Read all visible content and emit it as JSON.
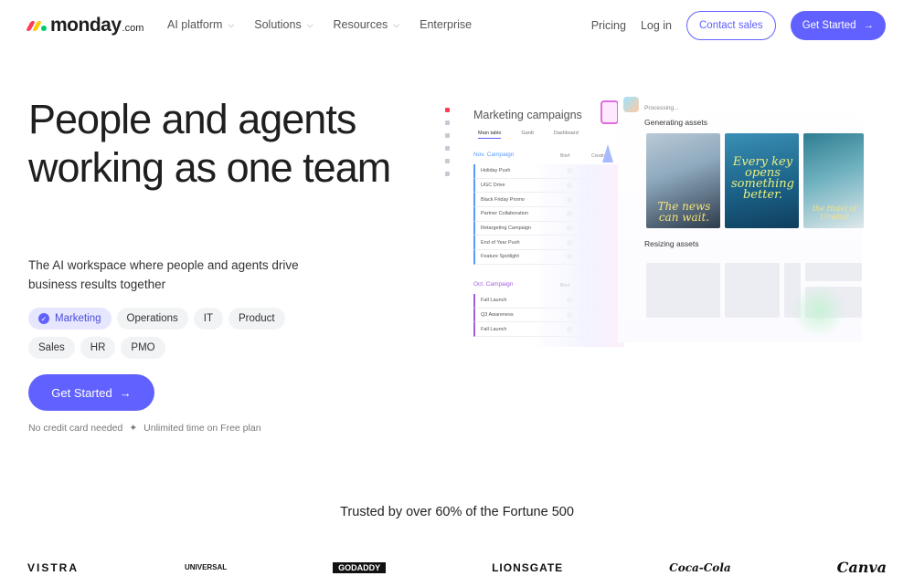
{
  "brand": {
    "name": "monday",
    "suffix": ".com",
    "colors": [
      "#ff3d57",
      "#ffcb00",
      "#00ca72"
    ]
  },
  "nav": {
    "items": [
      {
        "label": "AI platform",
        "dropdown": true
      },
      {
        "label": "Solutions",
        "dropdown": true
      },
      {
        "label": "Resources",
        "dropdown": true
      },
      {
        "label": "Enterprise",
        "dropdown": false
      }
    ],
    "pricing": "Pricing",
    "login": "Log in",
    "contact": "Contact sales",
    "get_started": "Get Started"
  },
  "hero": {
    "title": "People and agents working as one team",
    "subtitle": "The AI workspace where people and agents drive business results together",
    "chips": [
      {
        "label": "Marketing",
        "selected": true
      },
      {
        "label": "Operations",
        "selected": false
      },
      {
        "label": "IT",
        "selected": false
      },
      {
        "label": "Product",
        "selected": false
      },
      {
        "label": "Sales",
        "selected": false
      },
      {
        "label": "HR",
        "selected": false
      },
      {
        "label": "PMO",
        "selected": false
      }
    ],
    "cta": "Get Started",
    "note_1": "No credit card needed",
    "note_sep": "✦",
    "note_2": "Unlimited time on Free plan"
  },
  "mockup": {
    "board_title": "Marketing campaigns",
    "tabs": [
      "Main table",
      "Gantt",
      "Dashboard"
    ],
    "group_nov": "Nov. Campaign",
    "group_oct": "Oct. Campaign",
    "col_brief": "Brief",
    "col_creatives": "Creatives",
    "nov_rows": [
      "Holiday Push",
      "UGC Drive",
      "Black Friday Promo",
      "Partner Collaboration",
      "Retargeting Campaign",
      "End of Year Push",
      "Feature Spotlight"
    ],
    "oct_rows": [
      "Fall Launch",
      "Q3 Awareness",
      "Fall Launch"
    ],
    "processing": "Processing...",
    "generating": "Generating assets",
    "resizing": "Resizing assets",
    "asset_captions": [
      "The news can wait.",
      "Every key opens something better.",
      "the Hotel of Unwind"
    ]
  },
  "trusted": {
    "heading": "Trusted by over 60% of the Fortune 500",
    "logos": [
      "VISTRA",
      "UNIVERSAL",
      "GODADDY",
      "LIONSGATE",
      "Coca-Cola",
      "Canva"
    ]
  },
  "accent": "#6161ff"
}
